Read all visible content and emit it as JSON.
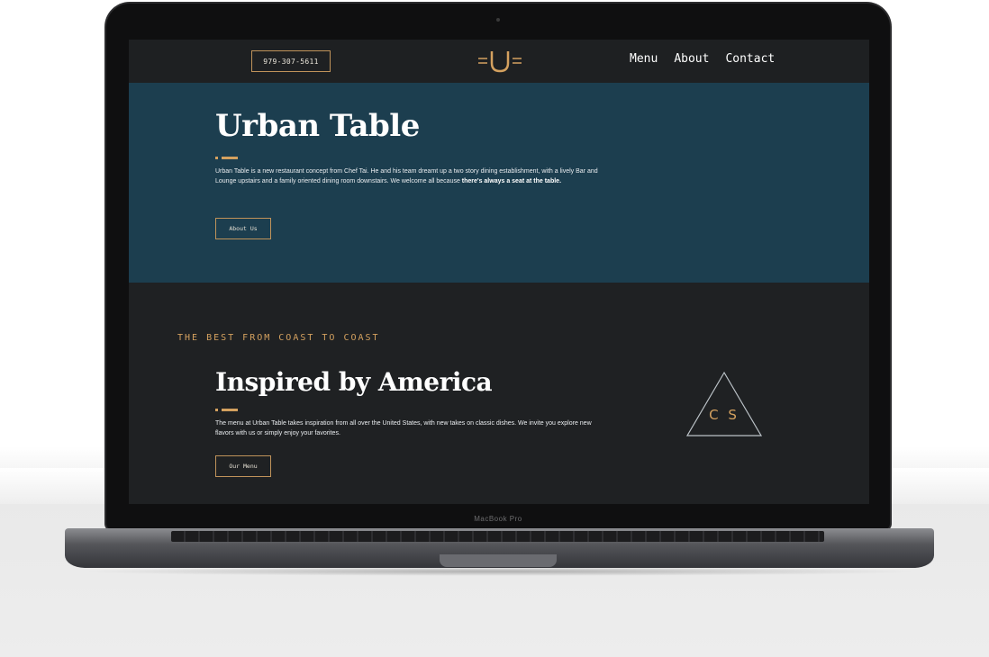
{
  "device": {
    "model_label": "MacBook Pro"
  },
  "site": {
    "nav": {
      "phone": "979-307-5611",
      "logo_letter": "U",
      "links": [
        "Menu",
        "About",
        "Contact"
      ]
    },
    "hero": {
      "title": "Urban Table",
      "body_plain": "Urban Table is a new restaurant concept from Chef Tai. He and his team dreamt up a two story dining establishment, with a lively Bar and Lounge upstairs and a family oriented dining room downstairs. We welcome all because ",
      "body_bold": "there's always a seat at the table.",
      "button": "About Us"
    },
    "inspired": {
      "eyebrow": "THE BEST FROM COAST TO COAST",
      "title": "Inspired by America",
      "body": "The menu at Urban Table takes inspiration from all over the United States, with new takes on classic dishes. We invite you explore new flavors with us or simply enjoy your favorites.",
      "button": "Our Menu",
      "badge_text": "C S"
    }
  },
  "colors": {
    "accent": "#d4a15f",
    "hero_bg": "#1c3e4f",
    "page_bg": "#1f2123"
  }
}
